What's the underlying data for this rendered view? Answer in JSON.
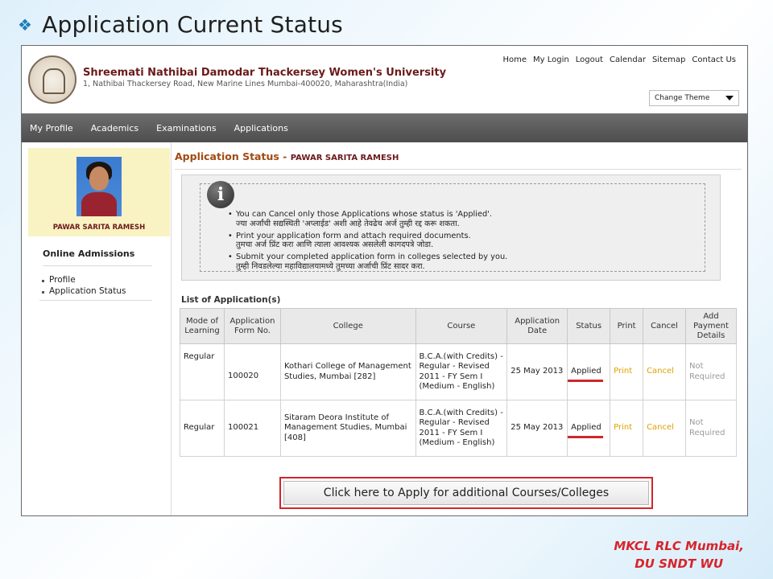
{
  "slide": {
    "title": "Application Current Status",
    "credits_line1": "MKCL RLC Mumbai,",
    "credits_line2": "DU SNDT WU"
  },
  "header": {
    "university_name": "Shreemati Nathibai Damodar Thackersey Women's University",
    "address": "1, Nathibai Thackersey Road, New Marine Lines Mumbai-400020, Maharashtra(India)",
    "top_links": [
      "Home",
      "My Login",
      "Logout",
      "Calendar",
      "Sitemap",
      "Contact Us"
    ],
    "theme_select": "Change Theme"
  },
  "navbar": {
    "items": [
      "My Profile",
      "Academics",
      "Examinations",
      "Applications"
    ]
  },
  "sidebar": {
    "student_name": "PAWAR SARITA RAMESH",
    "section_heading": "Online Admissions",
    "links": [
      "Profile",
      "Application Status"
    ]
  },
  "main": {
    "heading_label": "Application Status",
    "heading_sep": " - ",
    "heading_name": "PAWAR SARITA RAMESH",
    "info_icon": "i",
    "notes": [
      {
        "en": "You can Cancel only those Applications whose status is 'Applied'.",
        "mr": "ज्या अर्जांची सद्यस्थिती 'अप्लाईड' अशी आहे तेवढेच अर्ज तुम्ही रद्द करू शकता."
      },
      {
        "en": "Print your application form and attach required documents.",
        "mr": "तुमचा अर्ज प्रिंट करा आणि त्याला आवश्यक असलेली कागदपत्रे जोडा."
      },
      {
        "en": "Submit your completed application form in colleges selected by you.",
        "mr": "तुम्ही निवडलेल्या महाविद्यालयामध्ये तुमच्या अर्जाची प्रिंट सादर करा."
      }
    ],
    "list_title": "List of Application(s)",
    "columns": [
      "Mode of Learning",
      "Application Form No.",
      "College",
      "Course",
      "Application Date",
      "Status",
      "Print",
      "Cancel",
      "Add Payment Details"
    ],
    "rows": [
      {
        "mode": "Regular",
        "form_no": "100020",
        "college": "Kothari College of Management Studies, Mumbai [282]",
        "course": "B.C.A.(with Credits) - Regular - Revised 2011 - FY Sem I (Medium - English)",
        "date": "25 May 2013",
        "status": "Applied",
        "print": "Print",
        "cancel": "Cancel",
        "payment": "Not Required"
      },
      {
        "mode": "Regular",
        "form_no": "100021",
        "college": "Sitaram Deora Institute of Management Studies, Mumbai [408]",
        "course": "B.C.A.(with Credits) - Regular - Revised 2011 - FY Sem I (Medium - English)",
        "date": "25 May 2013",
        "status": "Applied",
        "print": "Print",
        "cancel": "Cancel",
        "payment": "Not Required"
      }
    ],
    "apply_button": "Click here to Apply for additional Courses/Colleges"
  },
  "colors": {
    "accent_red": "#d0262c",
    "heading_brown": "#a04a12",
    "link_gold": "#e0a100",
    "nav_gray": "#5c5c5c"
  }
}
